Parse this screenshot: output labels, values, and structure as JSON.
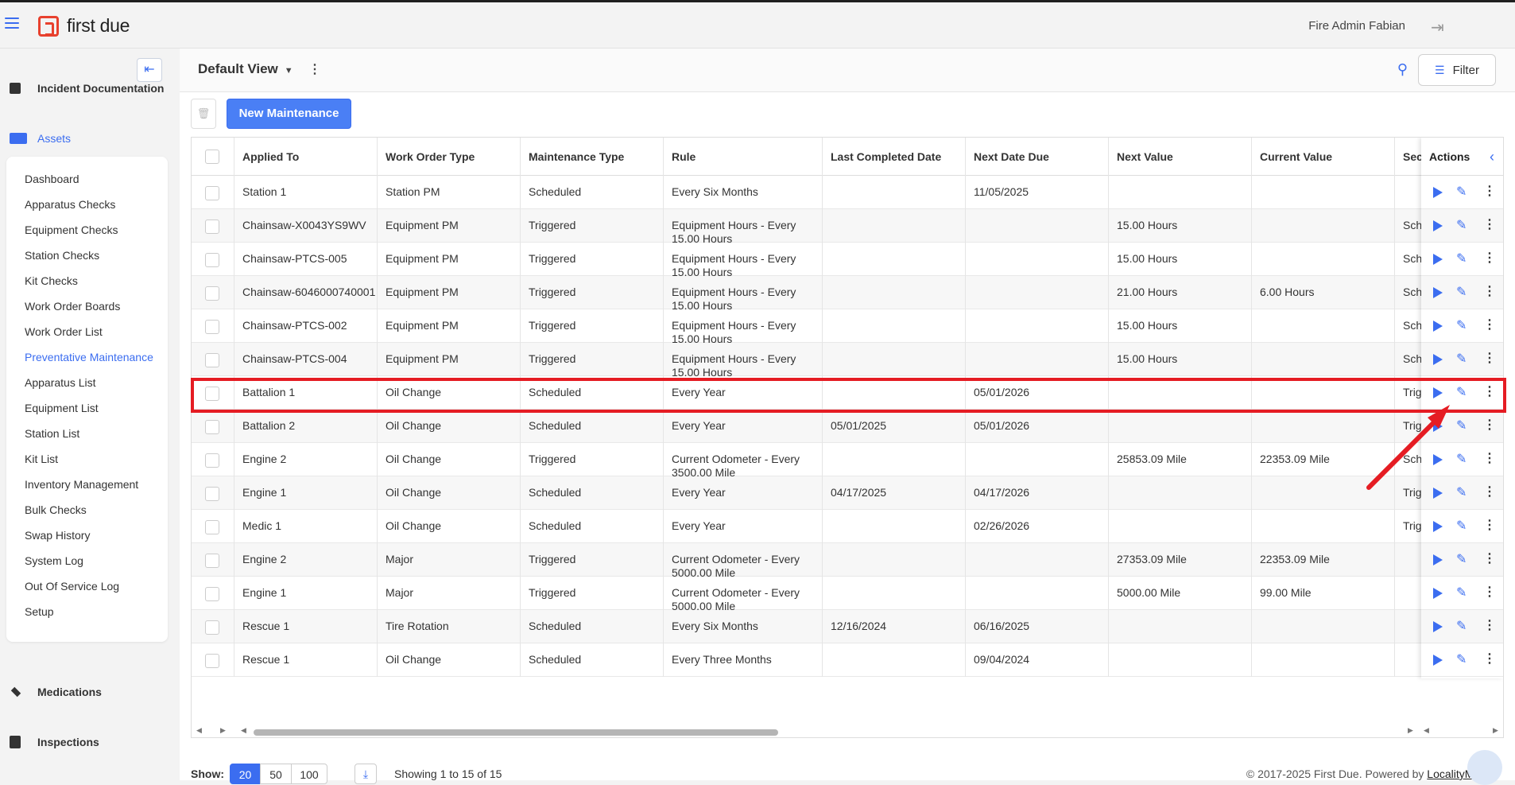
{
  "header": {
    "app_name": "first due",
    "user_name": "Fire Admin Fabian"
  },
  "sidebar": {
    "sections": [
      {
        "label": "Incident Documentation"
      },
      {
        "label": "Assets"
      },
      {
        "label": "Medications"
      },
      {
        "label": "Inspections"
      }
    ],
    "items": [
      {
        "label": "Dashboard"
      },
      {
        "label": "Apparatus Checks"
      },
      {
        "label": "Equipment Checks"
      },
      {
        "label": "Station Checks"
      },
      {
        "label": "Kit Checks"
      },
      {
        "label": "Work Order Boards"
      },
      {
        "label": "Work Order List"
      },
      {
        "label": "Preventative Maintenance"
      },
      {
        "label": "Apparatus List"
      },
      {
        "label": "Equipment List"
      },
      {
        "label": "Station List"
      },
      {
        "label": "Kit List"
      },
      {
        "label": "Inventory Management"
      },
      {
        "label": "Bulk Checks"
      },
      {
        "label": "Swap History"
      },
      {
        "label": "System Log"
      },
      {
        "label": "Out Of Service Log"
      },
      {
        "label": "Setup"
      }
    ],
    "active_item": "Preventative Maintenance"
  },
  "toolbar": {
    "view_name": "Default View",
    "filter_label": "Filter",
    "new_button": "New Maintenance"
  },
  "table": {
    "columns": [
      "Applied To",
      "Work Order Type",
      "Maintenance Type",
      "Rule",
      "Last Completed Date",
      "Next Date Due",
      "Next Value",
      "Current Value",
      "Sec"
    ],
    "actions_header": "Actions",
    "rows": [
      [
        "Station 1",
        "Station PM",
        "Scheduled",
        "Every Six Months",
        "",
        "11/05/2025",
        "",
        "",
        ""
      ],
      [
        "Chainsaw-X0043YS9WV",
        "Equipment PM",
        "Triggered",
        "Equipment Hours - Every 15.00 Hours",
        "",
        "",
        "15.00 Hours",
        "",
        "Sch"
      ],
      [
        "Chainsaw-PTCS-005",
        "Equipment PM",
        "Triggered",
        "Equipment Hours - Every 15.00 Hours",
        "",
        "",
        "15.00 Hours",
        "",
        "Sch"
      ],
      [
        "Chainsaw-6046000740001",
        "Equipment PM",
        "Triggered",
        "Equipment Hours - Every 15.00 Hours",
        "",
        "",
        "21.00 Hours",
        "6.00 Hours",
        "Sch"
      ],
      [
        "Chainsaw-PTCS-002",
        "Equipment PM",
        "Triggered",
        "Equipment Hours - Every 15.00 Hours",
        "",
        "",
        "15.00 Hours",
        "",
        "Sch"
      ],
      [
        "Chainsaw-PTCS-004",
        "Equipment PM",
        "Triggered",
        "Equipment Hours - Every 15.00 Hours",
        "",
        "",
        "15.00 Hours",
        "",
        "Sch"
      ],
      [
        "Battalion 1",
        "Oil Change",
        "Scheduled",
        "Every Year",
        "",
        "05/01/2026",
        "",
        "",
        "Trig"
      ],
      [
        "Battalion 2",
        "Oil Change",
        "Scheduled",
        "Every Year",
        "05/01/2025",
        "05/01/2026",
        "",
        "",
        "Trig"
      ],
      [
        "Engine 2",
        "Oil Change",
        "Triggered",
        "Current Odometer - Every 3500.00 Mile",
        "",
        "",
        "25853.09 Mile",
        "22353.09 Mile",
        "Sch"
      ],
      [
        "Engine 1",
        "Oil Change",
        "Scheduled",
        "Every Year",
        "04/17/2025",
        "04/17/2026",
        "",
        "",
        "Trig"
      ],
      [
        "Medic 1",
        "Oil Change",
        "Scheduled",
        "Every Year",
        "",
        "02/26/2026",
        "",
        "",
        "Trig"
      ],
      [
        "Engine 2",
        "Major",
        "Triggered",
        "Current Odometer - Every 5000.00 Mile",
        "",
        "",
        "27353.09 Mile",
        "22353.09 Mile",
        ""
      ],
      [
        "Engine 1",
        "Major",
        "Triggered",
        "Current Odometer - Every 5000.00 Mile",
        "",
        "",
        "5000.00 Mile",
        "99.00 Mile",
        ""
      ],
      [
        "Rescue 1",
        "Tire Rotation",
        "Scheduled",
        "Every Six Months",
        "12/16/2024",
        "06/16/2025",
        "",
        "",
        ""
      ],
      [
        "Rescue 1",
        "Oil Change",
        "Scheduled",
        "Every Three Months",
        "",
        "09/04/2024",
        "",
        "",
        ""
      ]
    ],
    "highlighted_row": 6
  },
  "footer": {
    "show_label": "Show:",
    "page_sizes": [
      "20",
      "50",
      "100"
    ],
    "selected_page_size": "20",
    "showing_text": "Showing 1 to 15 of 15",
    "copyright": "© 2017-2025 First Due. Powered by",
    "powered_link": "LocalityMed"
  },
  "colors": {
    "accent": "#3b6df0",
    "highlight": "#e51c23"
  }
}
